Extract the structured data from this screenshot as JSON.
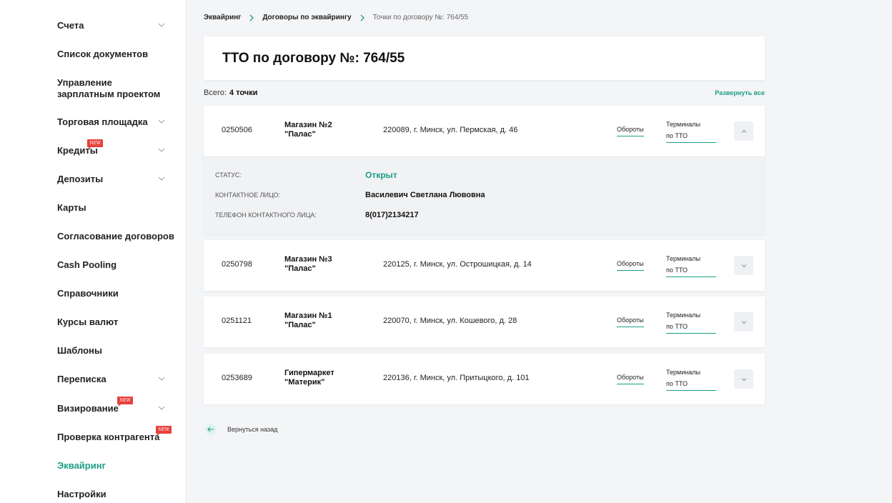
{
  "sidebar": {
    "items": [
      {
        "label": "Счета",
        "has_chevron": true
      },
      {
        "label": "Список документов"
      },
      {
        "label": "Управление\nзарплатным проектом"
      },
      {
        "label": "Торговая площадка",
        "has_chevron": true
      },
      {
        "label": "Кредиты",
        "has_chevron": true,
        "badge": "NEW"
      },
      {
        "label": "Депозиты",
        "has_chevron": true
      },
      {
        "label": "Карты"
      },
      {
        "label": "Согласование договоров"
      },
      {
        "label": "Cash Pooling"
      },
      {
        "label": "Справочники"
      },
      {
        "label": "Курсы валют"
      },
      {
        "label": "Шаблоны"
      },
      {
        "label": "Переписка",
        "has_chevron": true
      },
      {
        "label": "Визирование",
        "has_chevron": true,
        "badge": "NEW"
      },
      {
        "label": "Проверка контрагента",
        "badge": "NEW"
      },
      {
        "label": "Эквайринг",
        "active": true
      },
      {
        "label": "Настройки"
      }
    ]
  },
  "breadcrumb": {
    "items": [
      "Эквайринг",
      "Договоры по эквайрингу",
      "Точки по договору №: 764/55"
    ]
  },
  "page": {
    "title": "ТТО по договору №: 764/55",
    "total_label": "Всего:",
    "total_value": "4 точки",
    "expand_all": "Развернуть все",
    "back_label": "Вернуться назад"
  },
  "points": [
    {
      "code": "0250506",
      "name": "Магазин №2\n\"Палас\"",
      "address": "220089, г. Минск, ул. Пермская, д. 46",
      "turnover": "Обороты",
      "terminals": "Терминалы\nпо ТТО",
      "expanded": true,
      "details": {
        "status_label": "СТАТУС:",
        "status_value": "Открыт",
        "contact_label": "КОНТАКТНОЕ ЛИЦО:",
        "contact_value": "Василевич Светлана Лювовна",
        "phone_label": "ТЕЛЕФОН КОНТАКТНОГО ЛИЦА:",
        "phone_value": "8(017)2134217"
      }
    },
    {
      "code": "0250798",
      "name": "Магазин №3\n\"Палас\"",
      "address": "220125, г. Минск, ул. Острошицкая, д. 14",
      "turnover": "Обороты",
      "terminals": "Терминалы\nпо ТТО",
      "expanded": false
    },
    {
      "code": "0251121",
      "name": "Магазин №1\n\"Палас\"",
      "address": "220070, г. Минск, ул. Кошевого, д. 28",
      "turnover": "Обороты",
      "terminals": "Терминалы\nпо ТТО",
      "expanded": false
    },
    {
      "code": "0253689",
      "name": "Гипермаркет\n\"Материк\"",
      "address": "220136, г. Минск, ул. Притыцкого, д. 101",
      "turnover": "Обороты",
      "terminals": "Терминалы\nпо ТТО",
      "expanded": false
    }
  ],
  "colors": {
    "accent": "#1a9e86",
    "badge": "#e8413c"
  }
}
